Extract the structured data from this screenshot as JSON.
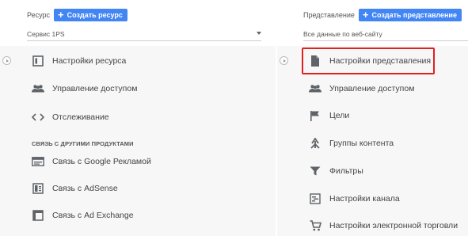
{
  "left": {
    "header_label": "Ресурс",
    "create_button": "Создать ресурс",
    "selector_value": "Сервис 1PS",
    "items": [
      {
        "label": "Настройки ресурса",
        "icon": "property-settings-icon"
      },
      {
        "label": "Управление доступом",
        "icon": "people-icon"
      },
      {
        "label": "Отслеживание",
        "icon": "code-icon"
      }
    ],
    "section_title": "СВЯЗЬ С ДРУГИМИ ПРОДУКТАМИ",
    "links": [
      {
        "label": "Связь с Google Рекламой",
        "icon": "google-ads-icon"
      },
      {
        "label": "Связь с AdSense",
        "icon": "adsense-icon"
      },
      {
        "label": "Связь с Ad Exchange",
        "icon": "ad-exchange-icon"
      }
    ]
  },
  "right": {
    "header_label": "Представление",
    "create_button": "Создать представление",
    "selector_value": "Все данные по веб-сайту",
    "items": [
      {
        "label": "Настройки представления",
        "icon": "document-icon"
      },
      {
        "label": "Управление доступом",
        "icon": "people-icon"
      },
      {
        "label": "Цели",
        "icon": "flag-icon"
      },
      {
        "label": "Группы контента",
        "icon": "content-grouping-icon"
      },
      {
        "label": "Фильтры",
        "icon": "filter-icon"
      },
      {
        "label": "Настройки канала",
        "icon": "channel-settings-icon"
      },
      {
        "label": "Настройки электронной торговли",
        "icon": "cart-icon"
      }
    ]
  },
  "highlight_color": "#e1201f",
  "accent_color": "#4285f4"
}
